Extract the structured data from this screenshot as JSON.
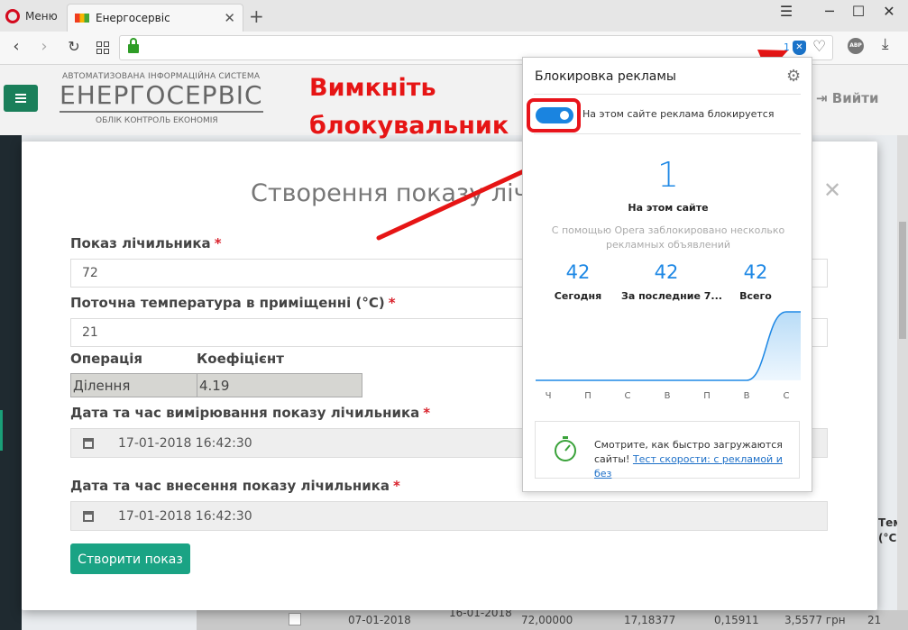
{
  "browser": {
    "menu_label": "Меню",
    "tab_title": "Енергосервіс",
    "adblock_count": "1",
    "abp_label": "ABP"
  },
  "header": {
    "logo_top": "АВТОМАТИЗОВАНА ІНФОРМАЦІЙНА СИСТЕМА",
    "logo_main": "ЕНЕРГОСЕРВІС",
    "logo_sub": "ОБЛІК КОНТРОЛЬ ЕКОНОМІЯ",
    "logout_label": "Вийти"
  },
  "modal": {
    "title": "Створення показу лічильника",
    "meter_label": "Показ лічильника",
    "meter_value": "72",
    "temp_label": "Поточна температура в приміщенні (°C)",
    "temp_value": "21",
    "op_header": "Операція",
    "coef_header": "Коефіцієнт",
    "op_value": "Ділення",
    "coef_value": "4.19",
    "measure_date_label": "Дата та час вимірювання показу лічильника",
    "measure_date_value": "17-01-2018 16:42:30",
    "entry_date_label": "Дата та час внесення показу лічильника",
    "entry_date_value": "17-01-2018 16:42:30",
    "submit_label": "Створити показ",
    "required_mark": "*"
  },
  "annotation": {
    "line1": "Вимкніть",
    "line2": "блокувальник",
    "color": "#e61515"
  },
  "popup": {
    "title": "Блокировка рекламы",
    "toggle_on": true,
    "status": "На этом сайте реклама блокируется",
    "site_count": "1",
    "site_label": "На этом сайте",
    "description": "С помощью Opera заблокировано несколько рекламных объявлений",
    "stats": [
      {
        "value": "42",
        "label": "Сегодня"
      },
      {
        "value": "42",
        "label": "За последние 7..."
      },
      {
        "value": "42",
        "label": "Всего"
      }
    ],
    "chart_days": [
      "Ч",
      "П",
      "С",
      "В",
      "П",
      "В",
      "С"
    ],
    "chart_values": [
      0,
      0,
      0,
      0,
      0,
      0,
      42
    ],
    "speed_text": "Смотрите, как быстро загружаются сайты! ",
    "speed_link": "Тест скорости: с рекламой и без",
    "accent": "#1e88e5"
  },
  "background_table": {
    "cells": [
      "07-01-2018",
      "16-01-2018",
      "72,00000",
      "17,18377",
      "0,15911",
      "3,5577 грн",
      "21"
    ],
    "side_header": "Темп (°C)"
  }
}
